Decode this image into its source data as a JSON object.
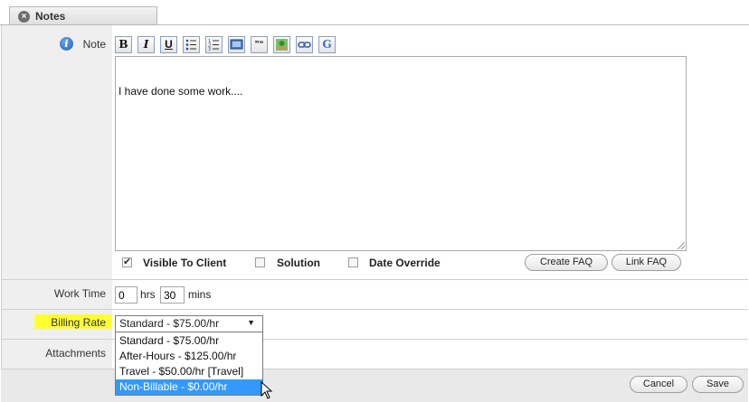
{
  "tab": {
    "title": "Notes",
    "close_icon": "close-icon"
  },
  "note": {
    "label": "Note",
    "toolbar": [
      "B",
      "I",
      "U",
      "bullet-list",
      "numbered-list",
      "image",
      "quote",
      "picture",
      "link",
      "google"
    ],
    "content": "I have done some work...."
  },
  "options": {
    "visible_to_client": {
      "label": "Visible To Client",
      "checked": true
    },
    "solution": {
      "label": "Solution",
      "checked": false
    },
    "date_override": {
      "label": "Date Override",
      "checked": false
    },
    "create_faq": "Create FAQ",
    "link_faq": "Link FAQ"
  },
  "work_time": {
    "label": "Work Time",
    "hrs_value": "0",
    "hrs_unit": "hrs",
    "mins_value": "30",
    "mins_unit": "mins"
  },
  "billing_rate": {
    "label": "Billing Rate",
    "selected": "Standard - $75.00/hr",
    "options": [
      "Standard - $75.00/hr",
      "After-Hours - $125.00/hr",
      "Travel - $50.00/hr [Travel]",
      "Non-Billable - $0.00/hr"
    ],
    "highlight_color": "#ffff33"
  },
  "attachments": {
    "label": "Attachments"
  },
  "footer": {
    "cancel": "Cancel",
    "save": "Save"
  }
}
